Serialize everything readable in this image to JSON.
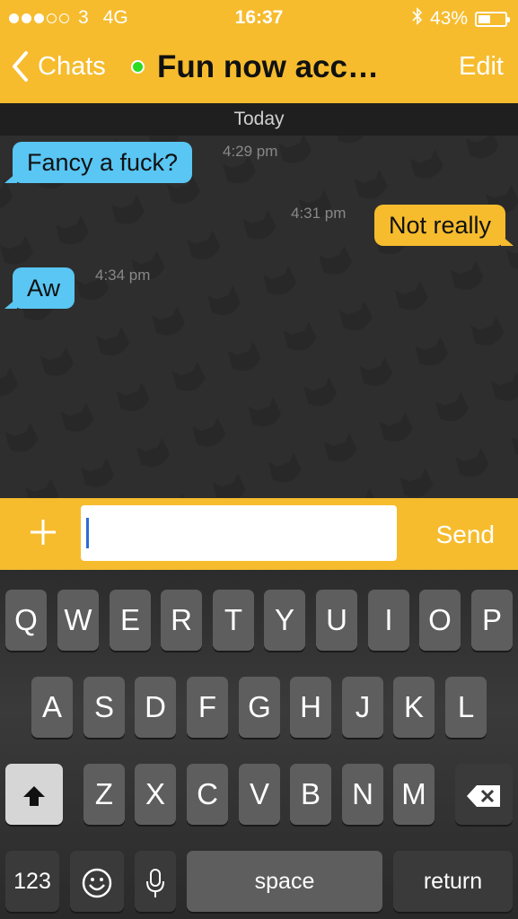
{
  "status": {
    "carrier": "3",
    "network": "4G",
    "time": "16:37",
    "battery": "43%",
    "battery_level": 0.43
  },
  "nav": {
    "back_label": "Chats",
    "title": "Fun now acc…",
    "edit_label": "Edit",
    "online": true
  },
  "chat": {
    "date_divider": "Today",
    "messages": [
      {
        "direction": "in",
        "text": "Fancy a fuck?",
        "time": "4:29 pm"
      },
      {
        "direction": "out",
        "text": "Not really",
        "time": "4:31 pm"
      },
      {
        "direction": "in",
        "text": "Aw",
        "time": "4:34 pm"
      }
    ]
  },
  "composer": {
    "value": "",
    "send_label": "Send"
  },
  "keyboard": {
    "row1": [
      "Q",
      "W",
      "E",
      "R",
      "T",
      "Y",
      "U",
      "I",
      "O",
      "P"
    ],
    "row2": [
      "A",
      "S",
      "D",
      "F",
      "G",
      "H",
      "J",
      "K",
      "L"
    ],
    "row3": [
      "Z",
      "X",
      "C",
      "V",
      "B",
      "N",
      "M"
    ],
    "numbers_label": "123",
    "space_label": "space",
    "return_label": "return"
  },
  "colors": {
    "accent": "#f6bc2e",
    "incoming": "#59c6f4",
    "online": "#2adc22"
  }
}
